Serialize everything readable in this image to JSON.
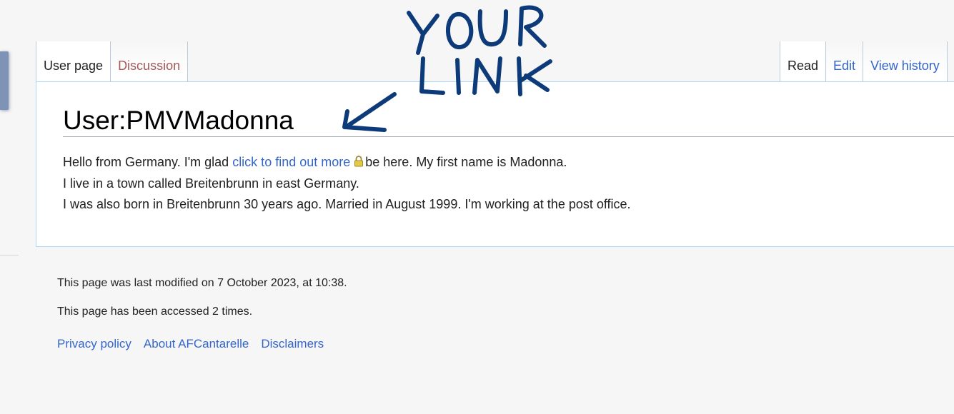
{
  "tabs_left": [
    {
      "label": "User page",
      "selected": true
    },
    {
      "label": "Discussion",
      "selected": false
    }
  ],
  "tabs_right": [
    {
      "label": "Read",
      "selected": true
    },
    {
      "label": "Edit",
      "selected": false
    },
    {
      "label": "View history",
      "selected": false
    }
  ],
  "page": {
    "title": "User:PMVMadonna",
    "line1_before": "Hello from Germany. I'm glad",
    "line1_link": "click to find out more",
    "line1_after": "be here. My first name is Madonna.",
    "line2": "I live in a town called Breitenbrunn in east Germany.",
    "line3": "I was also born in Breitenbrunn 30 years ago. Married in August 1999. I'm working at the post office."
  },
  "footer": {
    "last_modified": "This page was last modified on 7 October 2023, at 10:38.",
    "accessed": "This page has been accessed 2 times.",
    "links": [
      "Privacy policy",
      "About AFCantarelle",
      "Disclaimers"
    ]
  },
  "annotation": {
    "line1": "YOUR",
    "line2": "LINK",
    "ink_color": "#0d3b7a"
  },
  "icons": {
    "link_lock": "lock-icon"
  }
}
